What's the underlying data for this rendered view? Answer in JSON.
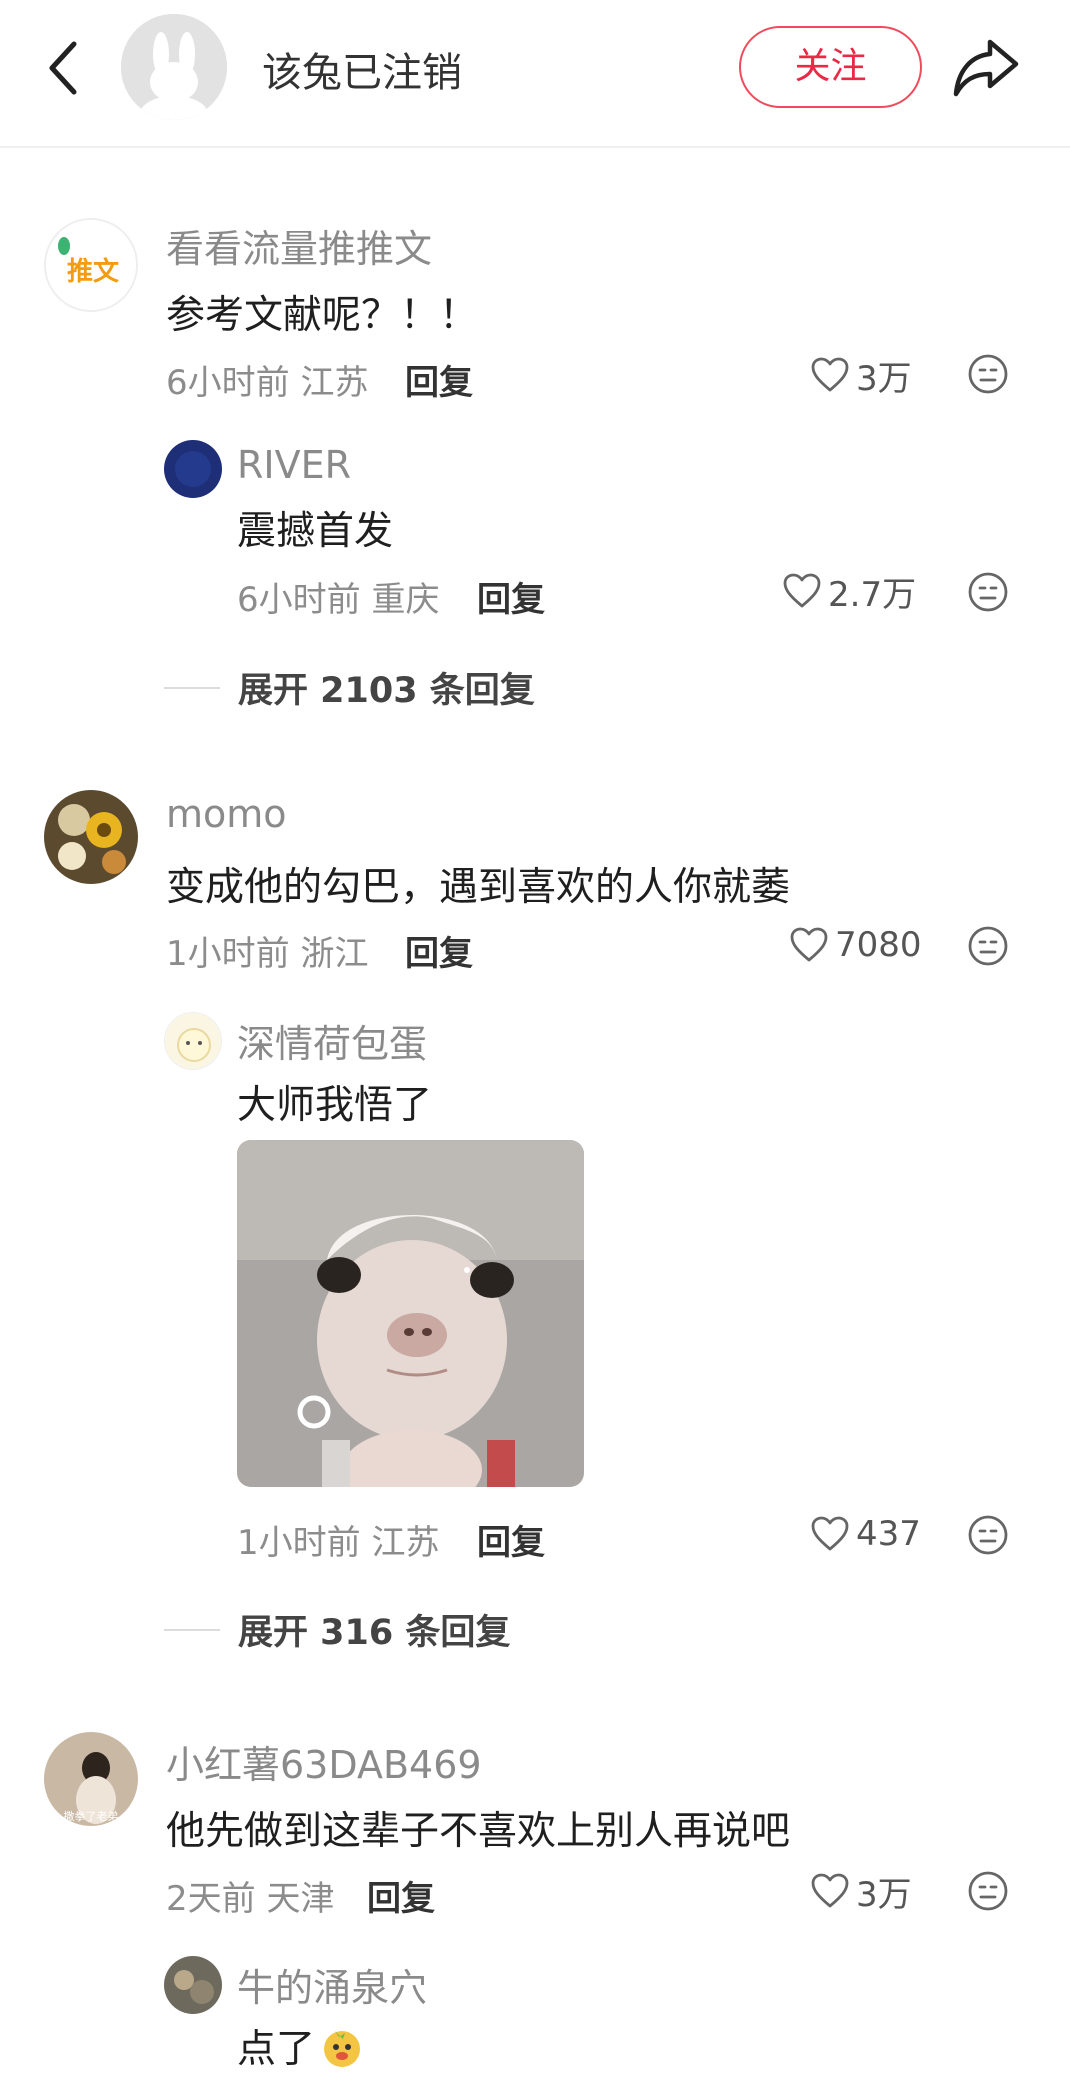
{
  "header": {
    "author_name": "该兔已注销",
    "follow_label": "关注"
  },
  "comments": [
    {
      "user": "看看流量推推文",
      "avatar_text": "推文",
      "text": "参考文献呢？！！",
      "time": "6小时前",
      "location": "江苏",
      "reply_label": "回复",
      "likes": "3万",
      "replies": [
        {
          "user": "RIVER",
          "text": "震撼首发",
          "time": "6小时前",
          "location": "重庆",
          "reply_label": "回复",
          "likes": "2.7万"
        }
      ],
      "expand_label": "展开 2103 条回复"
    },
    {
      "user": "momo",
      "text": "变成他的勾巴，遇到喜欢的人你就萎",
      "time": "1小时前",
      "location": "浙江",
      "reply_label": "回复",
      "likes": "7080",
      "replies": [
        {
          "user": "深情荷包蛋",
          "text": "大师我悟了",
          "time": "1小时前",
          "location": "江苏",
          "reply_label": "回复",
          "likes": "437"
        }
      ],
      "expand_label": "展开 316 条回复"
    },
    {
      "user": "小红薯63DAB469",
      "avatar_text": "撒拳了老弟",
      "text": "他先做到这辈子不喜欢上别人再说吧",
      "time": "2天前",
      "location": "天津",
      "reply_label": "回复",
      "likes": "3万",
      "replies": [
        {
          "user": "牛的涌泉穴",
          "text": "点了"
        }
      ]
    }
  ],
  "colors": {
    "accent": "#ea2a45",
    "muted": "#8c8c8c",
    "text": "#1f1f1f"
  }
}
